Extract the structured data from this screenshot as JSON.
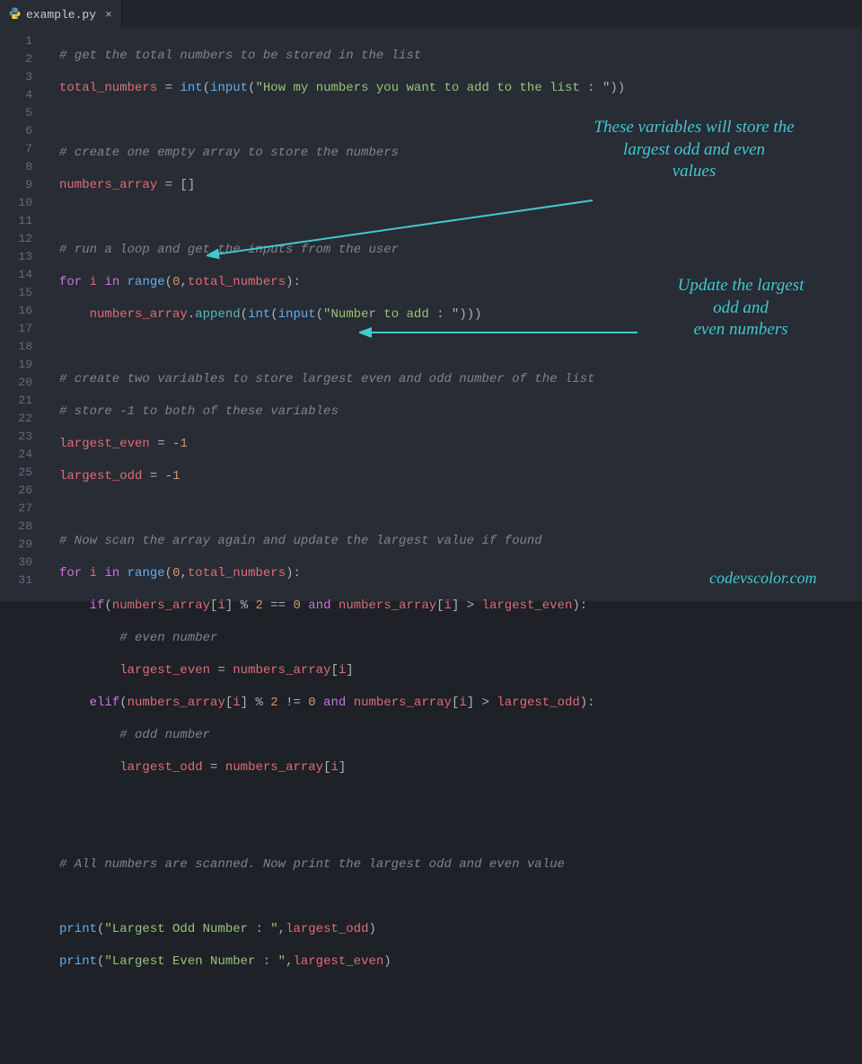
{
  "tab": {
    "filename": "example.py"
  },
  "lineCount": 31,
  "code": {
    "l1": {
      "comment": "# get the total numbers to be stored in the list"
    },
    "l2": {
      "var": "total_numbers",
      "eq": " = ",
      "fn1": "int",
      "paren1": "(",
      "fn2": "input",
      "paren2": "(",
      "str": "\"How my numbers you want to add to the list : \"",
      "close": "))"
    },
    "l4": {
      "comment": "# create one empty array to store the numbers"
    },
    "l5": {
      "var": "numbers_array",
      "rest": " = []"
    },
    "l7": {
      "comment": "# run a loop and get the inputs from the user"
    },
    "l8": {
      "kw1": "for",
      "sp1": " ",
      "i": "i",
      "sp2": " ",
      "kw2": "in",
      "sp3": " ",
      "fn": "range",
      "args_open": "(",
      "n": "0",
      "comma": ",",
      "var": "total_numbers",
      "close": "):"
    },
    "l9": {
      "indent": "    ",
      "var": "numbers_array",
      "dot": ".",
      "method": "append",
      "open": "(",
      "fn1": "int",
      "p1": "(",
      "fn2": "input",
      "p2": "(",
      "str": "\"Number to add : \"",
      "close": ")))"
    },
    "l11": {
      "comment": "# create two variables to store largest even and odd number of the list"
    },
    "l12": {
      "comment": "# store -1 to both of these variables"
    },
    "l13": {
      "var": "largest_even",
      "eq": " = ",
      "neg": "-",
      "num": "1"
    },
    "l14": {
      "var": "largest_odd",
      "eq": " = ",
      "neg": "-",
      "num": "1"
    },
    "l16": {
      "comment": "# Now scan the array again and update the largest value if found"
    },
    "l17": {
      "kw1": "for",
      "sp1": " ",
      "i": "i",
      "sp2": " ",
      "kw2": "in",
      "sp3": " ",
      "fn": "range",
      "open": "(",
      "n": "0",
      "comma": ",",
      "var": "total_numbers",
      "close": "):"
    },
    "l18": {
      "indent": "    ",
      "kw": "if",
      "open": "(",
      "var1": "numbers_array",
      "br1": "[",
      "i1": "i",
      "br2": "] % ",
      "two": "2",
      "eqeq": " == ",
      "zero": "0",
      "sp": " ",
      "and": "and",
      "sp2": " ",
      "var2": "numbers_array",
      "br3": "[",
      "i2": "i",
      "br4": "] > ",
      "var3": "largest_even",
      "close": "):"
    },
    "l19": {
      "indent": "        ",
      "comment": "# even number"
    },
    "l20": {
      "indent": "        ",
      "var1": "largest_even",
      "eq": " = ",
      "var2": "numbers_array",
      "br1": "[",
      "i": "i",
      "br2": "]"
    },
    "l21": {
      "indent": "    ",
      "kw": "elif",
      "open": "(",
      "var1": "numbers_array",
      "br1": "[",
      "i1": "i",
      "br2": "] % ",
      "two": "2",
      "neq": " != ",
      "zero": "0",
      "sp": " ",
      "and": "and",
      "sp2": " ",
      "var2": "numbers_array",
      "br3": "[",
      "i2": "i",
      "br4": "] > ",
      "var3": "largest_odd",
      "close": "):"
    },
    "l22": {
      "indent": "        ",
      "comment": "# odd number"
    },
    "l23": {
      "indent": "        ",
      "var1": "largest_odd",
      "eq": " = ",
      "var2": "numbers_array",
      "br1": "[",
      "i": "i",
      "br2": "]"
    },
    "l26": {
      "comment": "# All numbers are scanned. Now print the largest odd and even value"
    },
    "l28": {
      "fn": "print",
      "open": "(",
      "str": "\"Largest Odd Number : \"",
      "comma": ",",
      "var": "largest_odd",
      "close": ")"
    },
    "l29": {
      "fn": "print",
      "open": "(",
      "str": "\"Largest Even Number : \"",
      "comma": ",",
      "var": "largest_even",
      "close": ")"
    }
  },
  "annotations": {
    "a1": "These variables will store the\nlargest odd and even\nvalues",
    "a2": "Update the largest\nodd and\neven numbers",
    "watermark": "codevscolor.com"
  }
}
